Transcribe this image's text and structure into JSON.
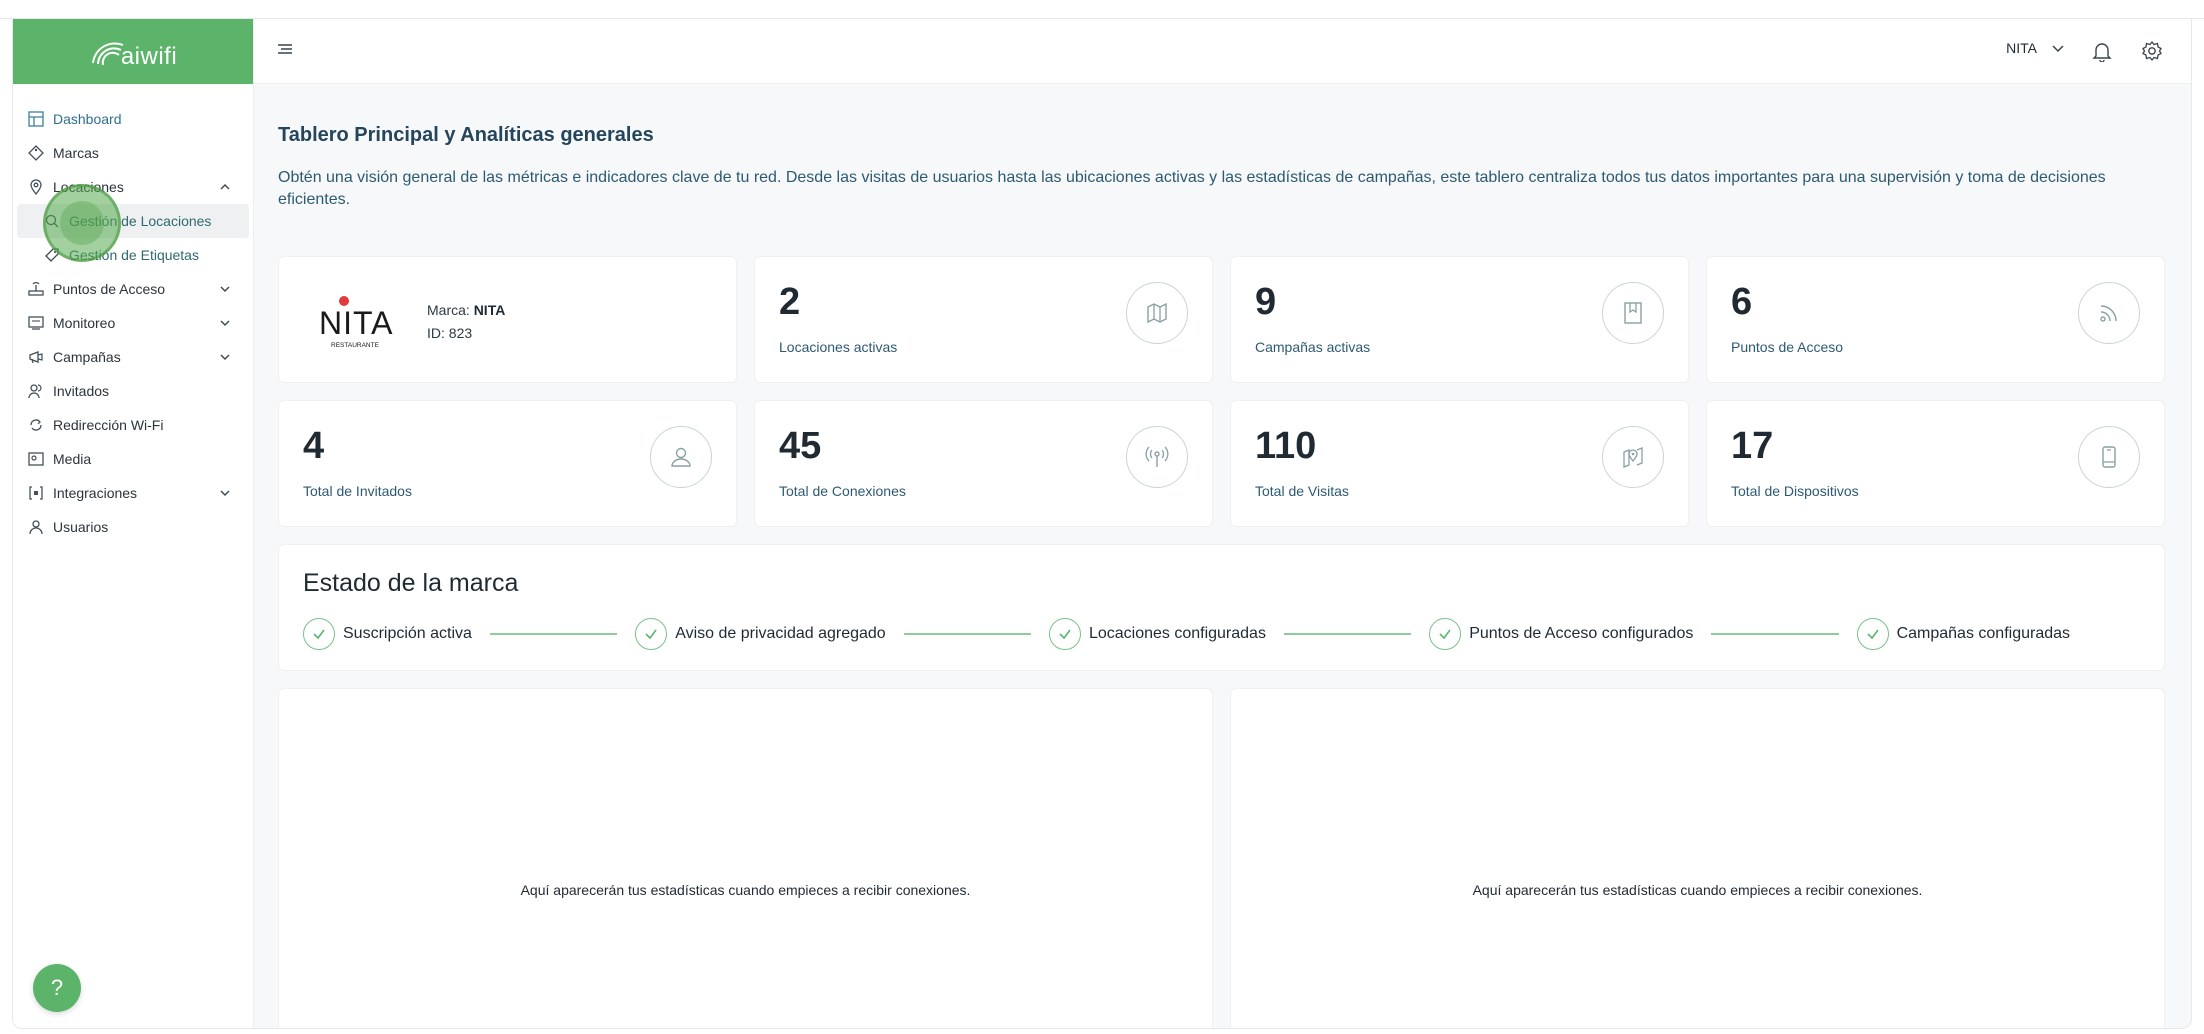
{
  "app": {
    "logo_text": "aiwifi"
  },
  "sidebar": {
    "items": [
      {
        "label": "Dashboard",
        "icon": "dashboard-icon"
      },
      {
        "label": "Marcas",
        "icon": "tag-icon"
      },
      {
        "label": "Locaciones",
        "icon": "map-pin-icon",
        "expanded": true
      },
      {
        "label": "Puntos de Acceso",
        "icon": "router-icon"
      },
      {
        "label": "Monitoreo",
        "icon": "monitor-icon"
      },
      {
        "label": "Campañas",
        "icon": "megaphone-icon"
      },
      {
        "label": "Invitados",
        "icon": "users-icon"
      },
      {
        "label": "Redirección Wi-Fi",
        "icon": "redirect-icon"
      },
      {
        "label": "Media",
        "icon": "media-icon"
      },
      {
        "label": "Integraciones",
        "icon": "integrations-icon"
      },
      {
        "label": "Usuarios",
        "icon": "user-icon"
      }
    ],
    "sub_items": [
      {
        "label": "Gestión de Locaciones",
        "icon": "location-search-icon"
      },
      {
        "label": "Gestión de Etiquetas",
        "icon": "label-icon"
      }
    ],
    "help_label": "?"
  },
  "header": {
    "brand_selected": "NITA"
  },
  "main": {
    "title": "Tablero Principal y Analíticas generales",
    "description": "Obtén una visión general de las métricas e indicadores clave de tu red. Desde las visitas de usuarios hasta las ubicaciones activas y las estadísticas de campañas, este tablero centraliza todos tus datos importantes para una supervisión y toma de decisiones eficientes.",
    "brand_card": {
      "logo_text": "NITA",
      "logo_sub": "RESTAURANTE",
      "marca_label": "Marca:",
      "marca_value": "NITA",
      "id_label": "ID:",
      "id_value": "823"
    },
    "stats": [
      {
        "value": "2",
        "label": "Locaciones activas",
        "icon": "map-icon"
      },
      {
        "value": "9",
        "label": "Campañas activas",
        "icon": "bookmark-icon"
      },
      {
        "value": "6",
        "label": "Puntos de Acceso",
        "icon": "signal-icon"
      },
      {
        "value": "4",
        "label": "Total de Invitados",
        "icon": "person-icon"
      },
      {
        "value": "45",
        "label": "Total de Conexiones",
        "icon": "antenna-icon"
      },
      {
        "value": "110",
        "label": "Total de Visitas",
        "icon": "map-pin-icon"
      },
      {
        "value": "17",
        "label": "Total de Dispositivos",
        "icon": "phone-icon"
      }
    ],
    "status": {
      "title": "Estado de la marca",
      "steps": [
        "Suscripción activa",
        "Aviso de privacidad agregado",
        "Locaciones configuradas",
        "Puntos de Acceso configurados",
        "Campañas configuradas"
      ]
    },
    "empty_message": "Aquí aparecerán tus estadísticas cuando empieces a recibir conexiones."
  },
  "colors": {
    "brand_green": "#5cb46a",
    "title_blue": "#24455c",
    "link_blue": "#2e6f8e"
  }
}
